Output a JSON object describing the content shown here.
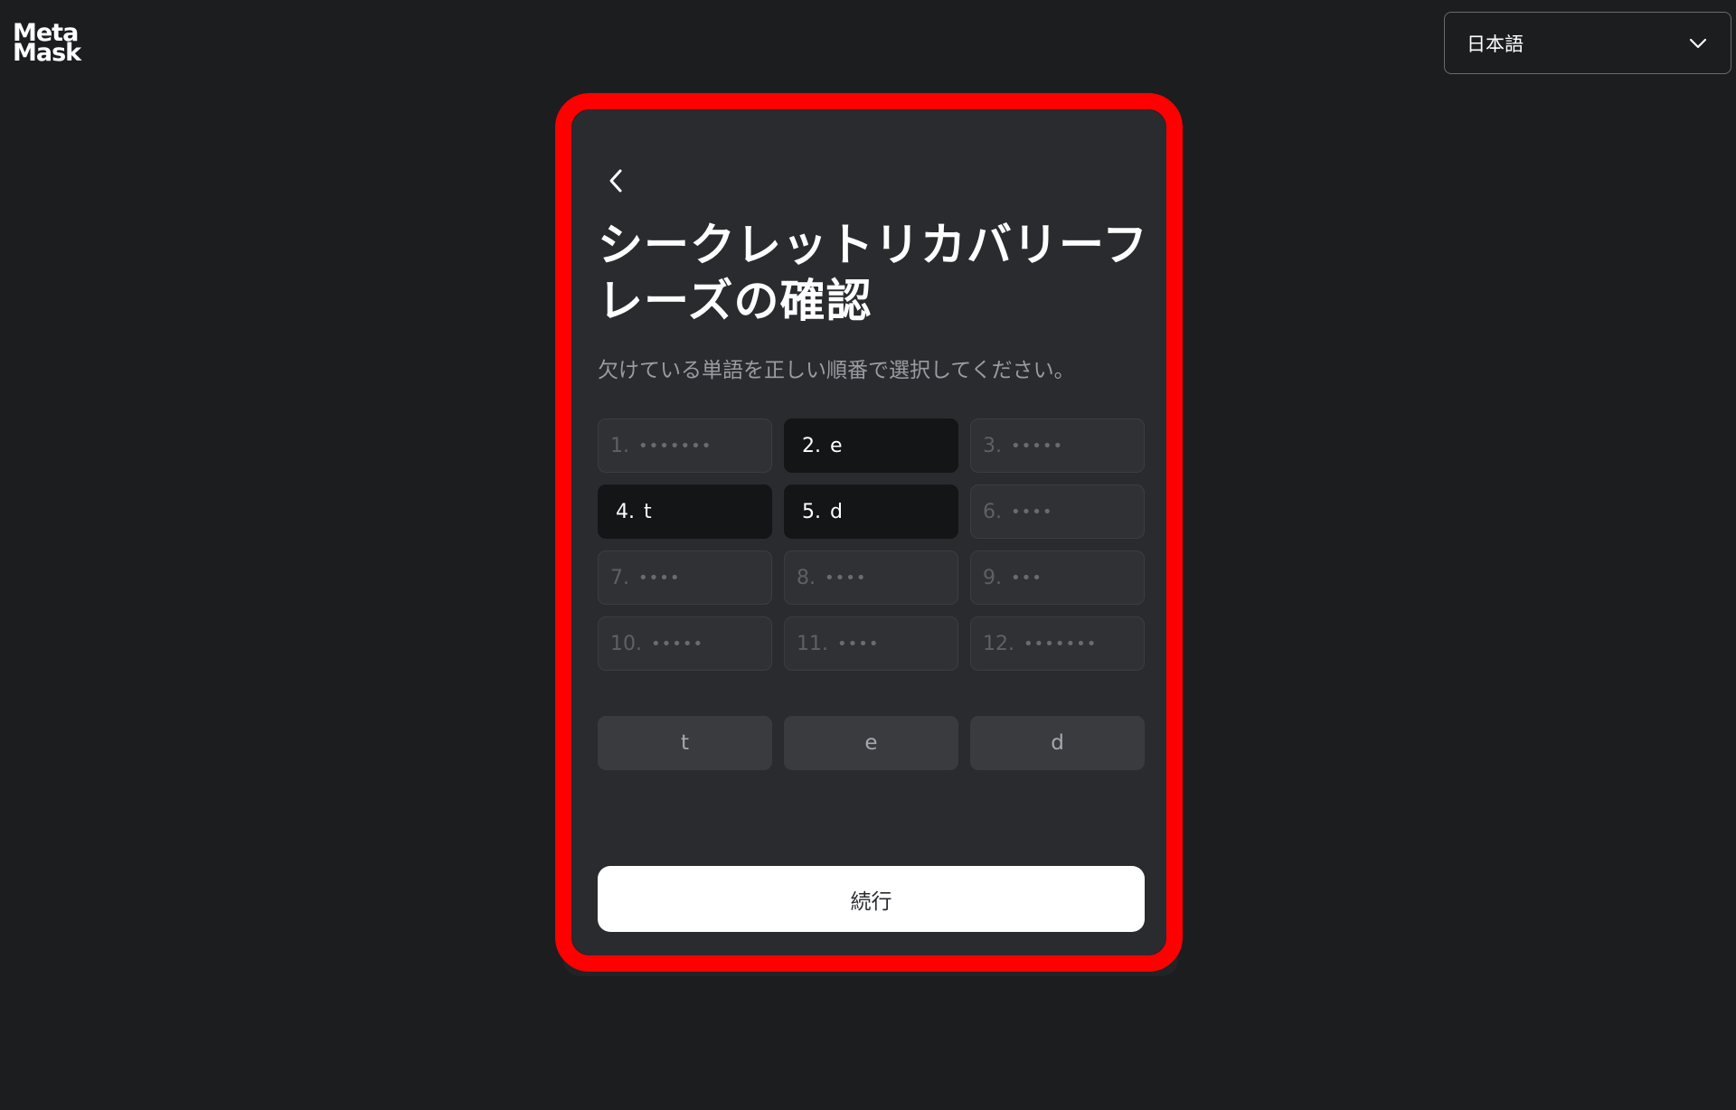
{
  "brand": {
    "logo_line1": "Meta",
    "logo_line2": "Mask"
  },
  "language_select": {
    "selected": "日本語",
    "icon": "chevron-down-icon"
  },
  "card": {
    "back_icon": "chevron-left-icon",
    "title": "シークレットリカバリーフレーズの確認",
    "subtitle": "欠けている単語を正しい順番で選択してください。",
    "words": [
      {
        "num": "1.",
        "text": "•••••••",
        "state": "hidden"
      },
      {
        "num": "2.",
        "text": "e",
        "state": "filled"
      },
      {
        "num": "3.",
        "text": "•••••",
        "state": "hidden"
      },
      {
        "num": "4.",
        "text": "t",
        "state": "filled"
      },
      {
        "num": "5.",
        "text": "d",
        "state": "filled"
      },
      {
        "num": "6.",
        "text": "••••",
        "state": "hidden"
      },
      {
        "num": "7.",
        "text": "••••",
        "state": "hidden"
      },
      {
        "num": "8.",
        "text": "••••",
        "state": "hidden"
      },
      {
        "num": "9.",
        "text": "•••",
        "state": "hidden"
      },
      {
        "num": "10.",
        "text": "•••••",
        "state": "hidden"
      },
      {
        "num": "11.",
        "text": "••••",
        "state": "hidden"
      },
      {
        "num": "12.",
        "text": "•••••••",
        "state": "hidden"
      }
    ],
    "choices": [
      "t",
      "e",
      "d"
    ],
    "continue_label": "続行"
  },
  "colors": {
    "page_bg": "#1c1d1f",
    "card_bg": "#2a2b2f",
    "highlight": "#ff0000",
    "filled_cell": "#141517",
    "hidden_cell": "#303135",
    "chip": "#3a3b3f",
    "button": "#ffffff"
  }
}
